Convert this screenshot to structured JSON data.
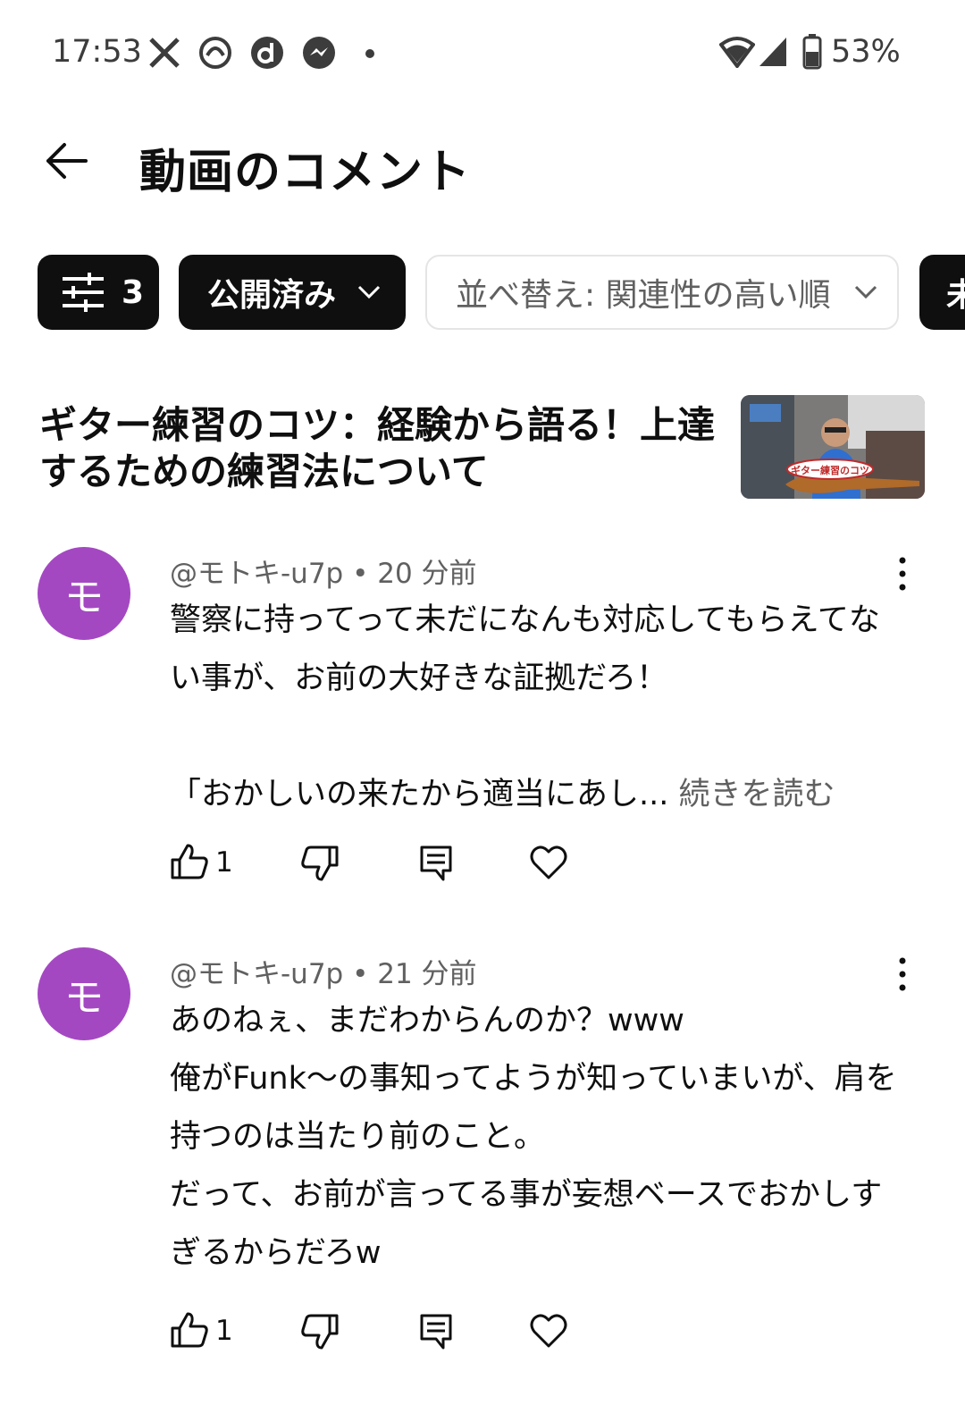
{
  "status_bar": {
    "time": "17:53",
    "battery": "53%",
    "notification_icons": [
      "x-icon",
      "app-icon",
      "d-icon",
      "messenger-icon"
    ]
  },
  "header": {
    "title": "動画のコメント"
  },
  "filters": {
    "filter_count": "3",
    "status_label": "公開済み",
    "sort_label": "並べ替え: 関連性の高い順",
    "partial_chip": "未"
  },
  "video": {
    "title": "ギター練習のコツ：経験から語る！上達するための練習法について",
    "thumbnail_caption": "ギター練習のコツ"
  },
  "comments": [
    {
      "avatar_letter": "モ",
      "author": "@モトキ-u7p",
      "time": "20 分前",
      "text": "警察に持ってって未だになんも対応してもらえてない事が、お前の大好きな証拠だろ！\n\n「おかしいの来たから適当にあし...",
      "read_more": "続きを読む",
      "likes": "1"
    },
    {
      "avatar_letter": "モ",
      "author": "@モトキ-u7p",
      "time": "21 分前",
      "text": "あのねぇ、まだわからんのか？www\n俺がFunk～の事知ってようが知っていまいが、肩を持つのは当たり前のこと。\nだって、お前が言ってる事が妄想ベースでおかしすぎるからだろw",
      "read_more": "",
      "likes": "1"
    }
  ],
  "colors": {
    "avatar": "#a448c2",
    "chip_dark": "#0f0f0f",
    "secondary_text": "#606060"
  }
}
